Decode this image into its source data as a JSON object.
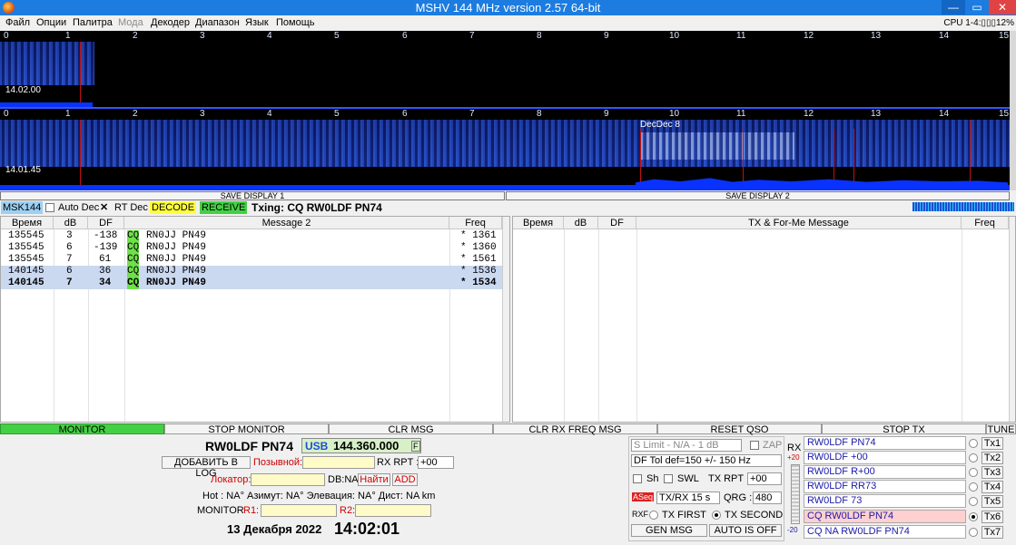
{
  "window": {
    "title": "MSHV 144 MHz version 2.57 64-bit",
    "minimize": "—",
    "maximize": "▭",
    "close": "✕"
  },
  "menu": [
    "Файл",
    "Опции",
    "Палитра",
    "Мода",
    "Декодер",
    "Диапазон",
    "Язык",
    "Помощь"
  ],
  "cpu": "CPU 1-4:▯▯▯12%",
  "ruler_ticks": [
    "0",
    "1",
    "2",
    "3",
    "4",
    "5",
    "6",
    "7",
    "8",
    "9",
    "10",
    "11",
    "12",
    "13",
    "14",
    "15"
  ],
  "waterfall": {
    "top_time": "14.02.00",
    "bottom_time": "14.01.45",
    "decode_marker": "DecDec 8",
    "save1": "SAVE DISPLAY 1",
    "save2": "SAVE DISPLAY 2"
  },
  "strip": {
    "mode": "MSK144",
    "auto_dec": "Auto Dec",
    "rt_dec": "RT Dec",
    "decode": "DECODE",
    "receive": "RECEIVE",
    "txing": "Txing: CQ RW0LDF PN74"
  },
  "left_table": {
    "headers": [
      "Время",
      "dB",
      "DF",
      "Message 2",
      "Freq"
    ],
    "rows": [
      {
        "time": "135545",
        "db": "3",
        "df": "-138",
        "cq": "CQ",
        "msg": "RN0JJ PN49",
        "freq": "* 1361"
      },
      {
        "time": "135545",
        "db": "6",
        "df": "-139",
        "cq": "CQ",
        "msg": "RN0JJ PN49",
        "freq": "* 1360"
      },
      {
        "time": "135545",
        "db": "7",
        "df": "61",
        "cq": "CQ",
        "msg": "RN0JJ PN49",
        "freq": "* 1561"
      },
      {
        "time": "140145",
        "db": "6",
        "df": "36",
        "cq": "CQ",
        "msg": "RN0JJ PN49",
        "freq": "* 1536"
      },
      {
        "time": "140145",
        "db": "7",
        "df": "34",
        "cq": "CQ",
        "msg": "RN0JJ PN49",
        "freq": "* 1534"
      }
    ]
  },
  "right_table": {
    "headers": [
      "Время",
      "dB",
      "DF",
      "TX & For-Me Message",
      "Freq"
    ]
  },
  "buttons": {
    "monitor": "MONITOR",
    "stop_monitor": "STOP MONITOR",
    "clr_msg": "CLR MSG",
    "clr_rx_freq": "CLR RX FREQ MSG",
    "reset_qso": "RESET QSO",
    "stop_tx": "STOP TX",
    "tune": "TUNE"
  },
  "station": {
    "call_loc": "RW0LDF PN74",
    "mode": "USB",
    "freq": "144.360.000",
    "f_btn": "F",
    "add_log": "ДОБАВИТЬ В LOG",
    "callsign_lbl": "Позывной:",
    "rx_rpt_lbl": "RX RPT :",
    "rx_rpt_val": "+00",
    "locator_lbl": "Локатор:",
    "db_na": "DB:NA",
    "find": "Найти",
    "add": "ADD",
    "info": "Hot : NA°  Азимут: NA°  Элевация: NA°  Дист: NA km",
    "monitor_lbl": "MONITOR",
    "r1": "R1:",
    "r2": "R2:",
    "date": "13 Декабря 2022",
    "time": "14:02:01"
  },
  "controls": {
    "s_limit": "S Limit - N/A - 1  dB",
    "zap": "ZAP",
    "df_tol": "DF Tol def=150 +/-  150  Hz",
    "sh": "Sh",
    "swl": "SWL",
    "tx_rpt_lbl": "TX RPT :",
    "tx_rpt_val": "+00",
    "aseq": "ASeq",
    "txrx": "TX/RX 15  s",
    "qrg_lbl": "QRG :",
    "qrg_val": "480",
    "rxf": "RXF",
    "tx_first": "TX FIRST",
    "tx_second": "TX SECOND",
    "gen_msg": "GEN MSG",
    "auto_off": "AUTO IS OFF",
    "rx": "RX",
    "plus20": "+20",
    "minus20": "-20"
  },
  "tx_messages": [
    {
      "text": "RW0LDF PN74",
      "btn": "Tx1"
    },
    {
      "text": "RW0LDF +00",
      "btn": "Tx2"
    },
    {
      "text": "RW0LDF R+00",
      "btn": "Tx3"
    },
    {
      "text": "RW0LDF RR73",
      "btn": "Tx4"
    },
    {
      "text": "RW0LDF 73",
      "btn": "Tx5"
    },
    {
      "text": "CQ RW0LDF PN74",
      "btn": "Tx6"
    },
    {
      "text": "CQ NA  RW0LDF PN74",
      "btn": "Tx7"
    }
  ],
  "colors": {
    "accent": "#1c7ce0",
    "cq_green": "#6ee04a",
    "decode_yellow": "#ffff3c",
    "receive_green": "#44d044"
  }
}
